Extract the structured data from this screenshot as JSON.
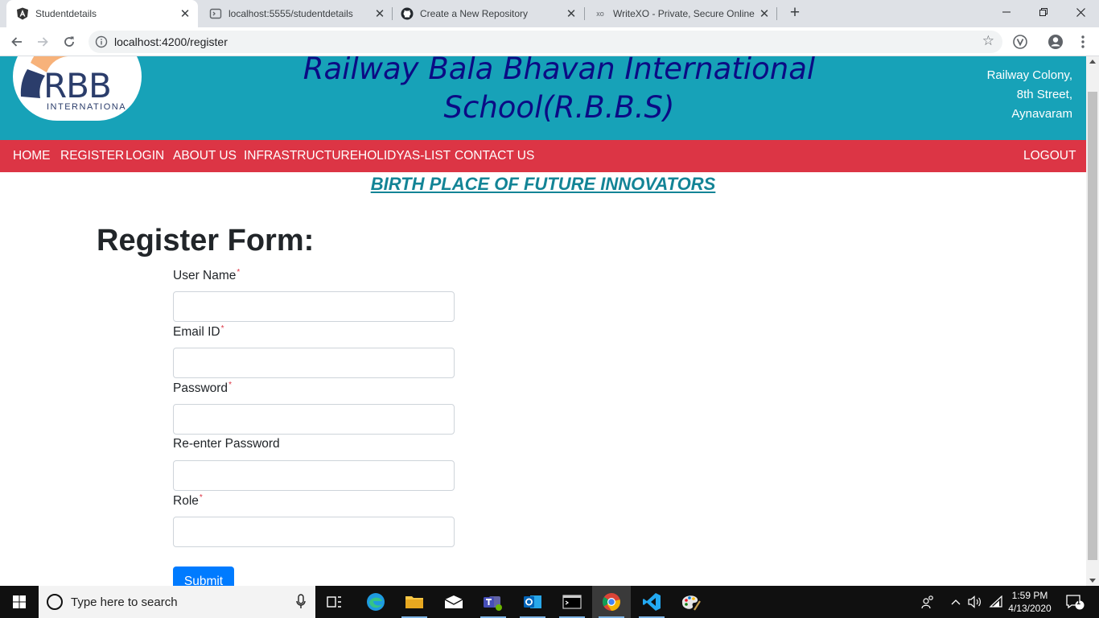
{
  "browser": {
    "tabs": [
      {
        "title": "Studentdetails",
        "icon": "angular-icon",
        "active": true
      },
      {
        "title": "localhost:5555/studentdetails",
        "icon": "page-icon",
        "active": false
      },
      {
        "title": "Create a New Repository",
        "icon": "github-icon",
        "active": false
      },
      {
        "title": "WriteXO - Private, Secure Online",
        "icon": "xo-icon",
        "active": false
      }
    ],
    "url": "localhost:4200/register",
    "xo_label": "xo"
  },
  "header": {
    "logo_text": "RBB",
    "logo_subtext": "INTERNATIONA",
    "school_name_line1": "Railway Bala Bhavan International",
    "school_name_line2": "School(R.B.B.S)",
    "address_lines": [
      "Railway Colony,",
      "8th Street,",
      "Aynavaram"
    ]
  },
  "nav": {
    "items": [
      "HOME",
      "REGISTER",
      "LOGIN",
      "ABOUT US",
      "INFRASTRUCTURE",
      "HOLIDYAS-LIST",
      "CONTACT US"
    ],
    "logout": "LOGOUT"
  },
  "tagline": "BIRTH PLACE OF FUTURE INNOVATORS",
  "form": {
    "title": "Register Form:",
    "fields": [
      {
        "label": "User Name",
        "required": true,
        "value": ""
      },
      {
        "label": "Email ID",
        "required": true,
        "value": ""
      },
      {
        "label": "Password",
        "required": true,
        "value": ""
      },
      {
        "label": "Re-enter Password",
        "required": false,
        "value": ""
      },
      {
        "label": "Role",
        "required": true,
        "value": ""
      }
    ],
    "required_mark": "*",
    "submit": "Submit"
  },
  "taskbar": {
    "search_placeholder": "Type here to search",
    "time": "1:59 PM",
    "date": "4/13/2020",
    "notification_count": "1"
  },
  "colors": {
    "header_bg": "#17a2b8",
    "navbar_bg": "#dc3545",
    "title_color": "#0b0b84",
    "tagline_color": "#138496",
    "submit_bg": "#007bff"
  }
}
